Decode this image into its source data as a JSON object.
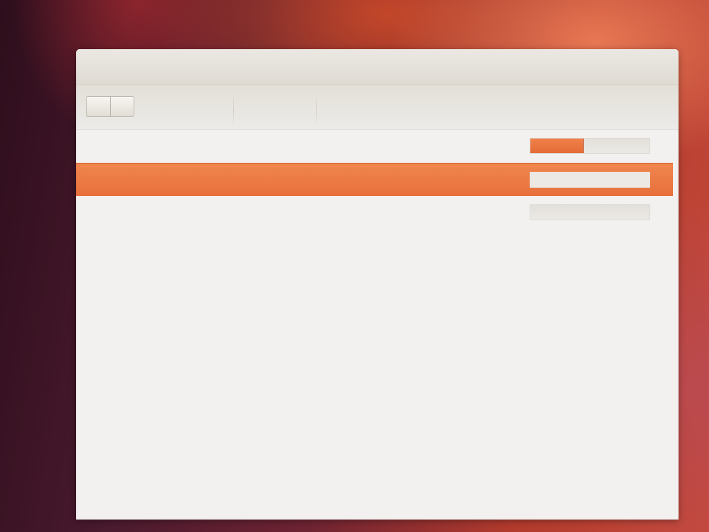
{
  "window": {
    "title": ""
  },
  "toolbar": {
    "back_label": "",
    "forward_label": ""
  },
  "downloads": [
    {
      "name": "",
      "status": "",
      "progress": 0.45,
      "selected": false
    },
    {
      "name": "",
      "status": "",
      "progress": 0.0,
      "selected": true
    },
    {
      "name": "",
      "status": "",
      "progress": 0.0,
      "selected": false
    }
  ],
  "colors": {
    "accent": "#e9713d",
    "window_bg": "#f2f1f0",
    "titlebar": "#e3dfd8"
  }
}
